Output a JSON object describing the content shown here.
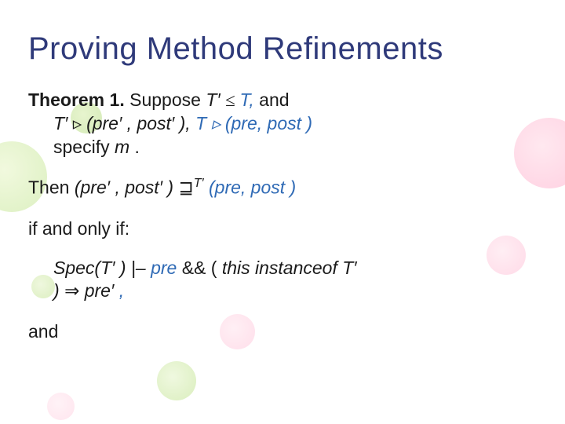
{
  "slide": {
    "title": "Proving Method Refinements",
    "theorem": {
      "label": "Theorem 1.",
      "suppose_pre": "Suppose ",
      "T_prime": "T′",
      "leq": " ≤ ",
      "T": "T,",
      "and": "  and",
      "line2_a": "T′",
      "line2_tri": " ▹ ",
      "line2_b": "(pre′",
      "line2_c": ", post′",
      "line2_d": " ), ",
      "line2_e": "T",
      "line2_tri2": " ▹ ",
      "line2_f": "(pre, post )",
      "specify": "specify ",
      "m": "m",
      "period": "."
    },
    "then": {
      "then": "Then ",
      "a": "(pre′",
      "b": ", post′",
      "c": " ) ",
      "refsym": "⊒",
      "sup": "T′",
      "d": "  (pre, post )"
    },
    "iff": "if and only if:",
    "spec": {
      "a": "Spec(T′",
      "a2": " ) |– ",
      "pre": "pre",
      "amp": " && (",
      "thisinst": "this instanceof ",
      "Tprime": "T′",
      "close": ") ",
      "imp": "⇒",
      "preprime": " pre′",
      "comma": ","
    },
    "and_final": "and"
  },
  "colors": {
    "title": "#2f3a7a",
    "body": "#1a1a1a",
    "accent": "#2f6ab5"
  }
}
